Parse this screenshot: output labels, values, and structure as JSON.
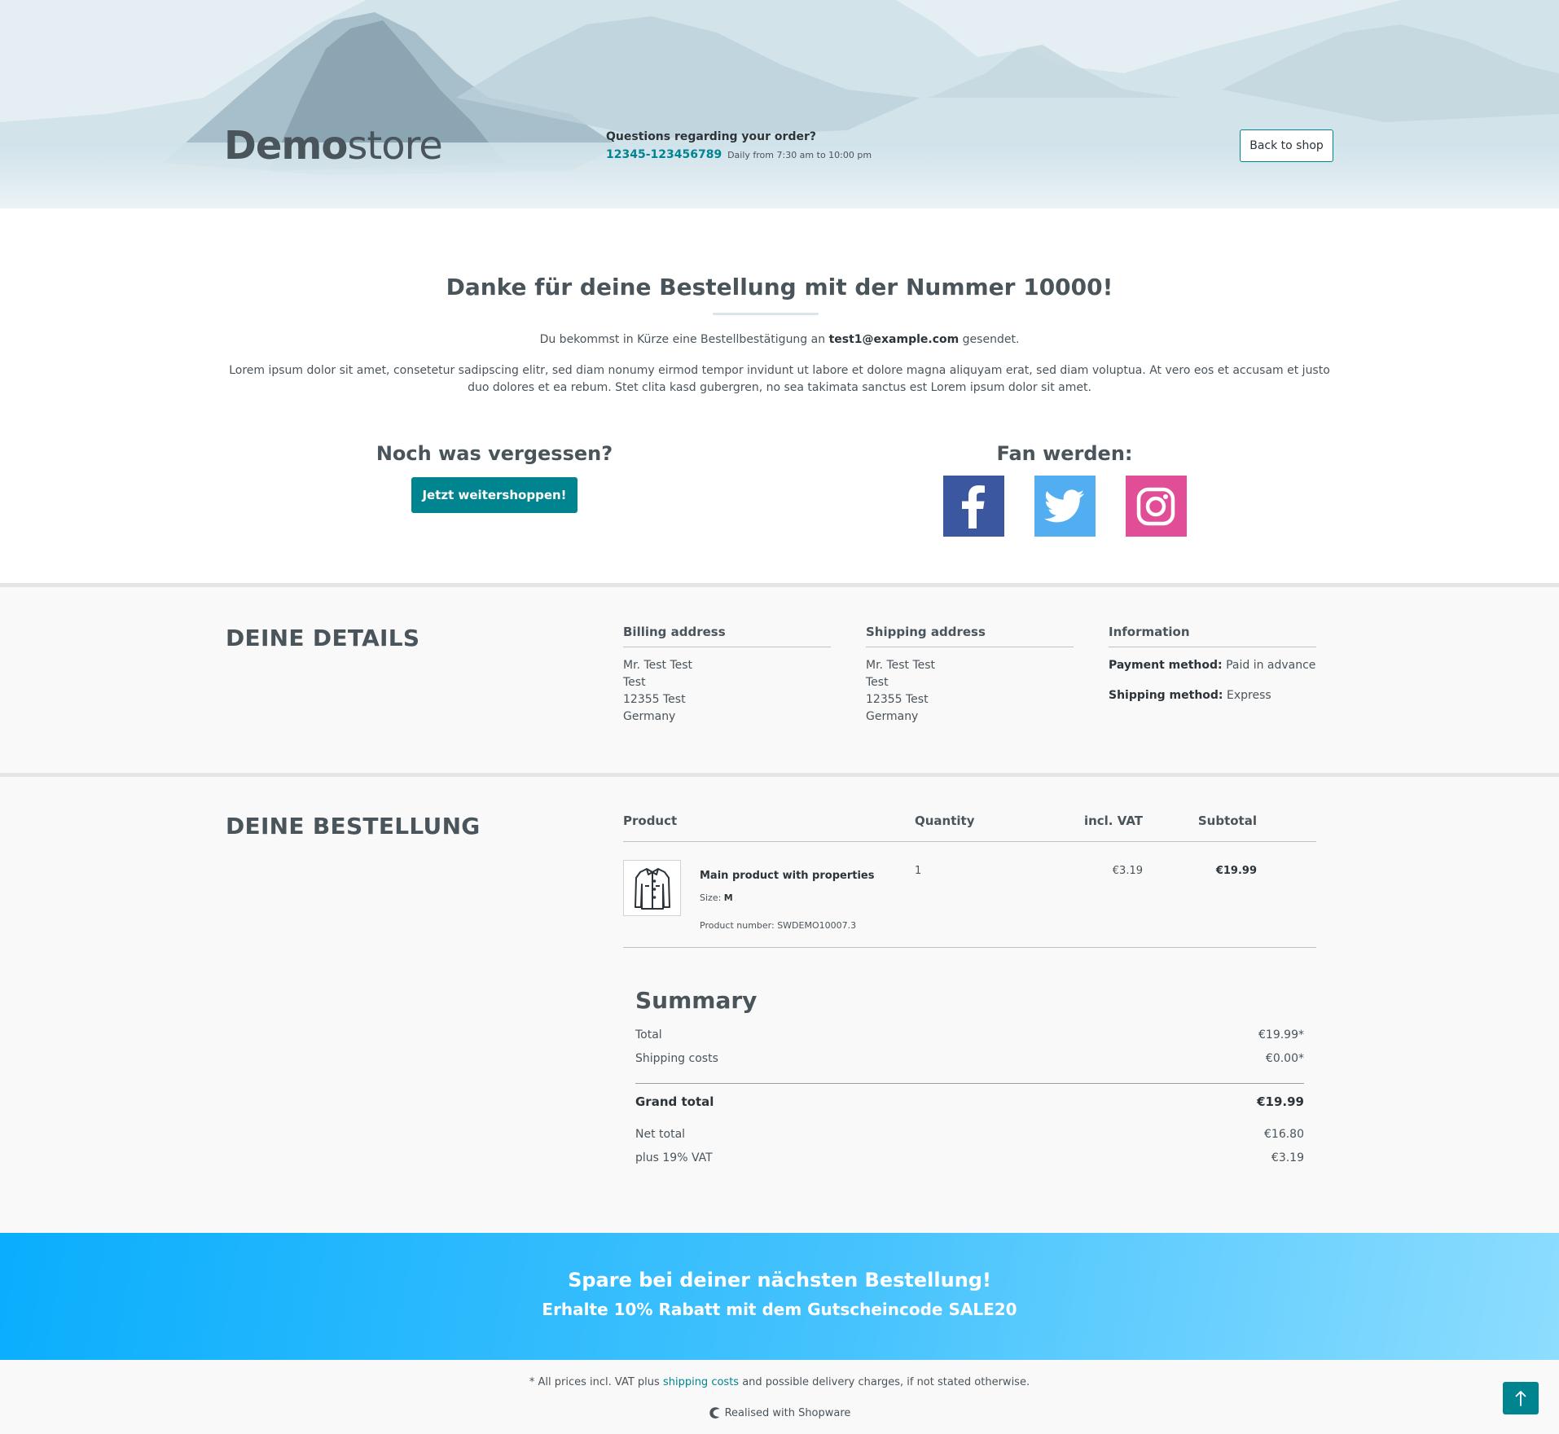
{
  "header": {
    "logo_bold": "Demo",
    "logo_light": "store",
    "hotline_question": "Questions regarding your order?",
    "hotline_number": "12345-123456789",
    "hotline_hours": "Daily from 7:30 am to 10:00 pm",
    "back_label": "Back to shop"
  },
  "thanks": {
    "title": "Danke für deine Bestellung mit der Nummer 10000!",
    "mail_prefix": "Du bekommst in Kürze eine Bestellbestätigung an",
    "mail_address": "test1@example.com",
    "mail_suffix": "gesendet.",
    "lorem": "Lorem ipsum dolor sit amet, consetetur sadipscing elitr, sed diam nonumy eirmod tempor invidunt ut labore et dolore magna aliquyam erat, sed diam voluptua. At vero eos et accusam et justo duo dolores et ea rebum. Stet clita kasd gubergren, no sea takimata sanctus est Lorem ipsum dolor sit amet.",
    "forgot_title": "Noch was vergessen?",
    "shop_button": "Jetzt weitershoppen!",
    "fan_title": "Fan werden:",
    "socials": [
      "facebook-icon",
      "twitter-icon",
      "instagram-icon"
    ]
  },
  "details": {
    "title": "DEINE DETAILS",
    "billing": {
      "heading": "Billing address",
      "lines": [
        "Mr. Test Test",
        "Test",
        "12355 Test",
        "Germany"
      ]
    },
    "shipping": {
      "heading": "Shipping address",
      "lines": [
        "Mr. Test Test",
        "Test",
        "12355 Test",
        "Germany"
      ]
    },
    "information": {
      "heading": "Information",
      "payment_label": "Payment method:",
      "payment_value": "Paid in advance",
      "shipping_label": "Shipping method:",
      "shipping_value": "Express"
    }
  },
  "order": {
    "title": "DEINE BESTELLUNG",
    "columns": [
      "Product",
      "Quantity",
      "incl. VAT",
      "Subtotal"
    ],
    "items": [
      {
        "name": "Main product with properties",
        "size_label": "Size:",
        "size_value": "M",
        "number": "Product number: SWDEMO10007.3",
        "quantity": "1",
        "vat": "€3.19",
        "subtotal": "€19.99",
        "thumbnail": "jacket-icon"
      }
    ]
  },
  "summary": {
    "title": "Summary",
    "total_label": "Total",
    "total_value": "€19.99*",
    "shipping_label": "Shipping costs",
    "shipping_value": "€0.00*",
    "grand_label": "Grand total",
    "grand_value": "€19.99",
    "net_label": "Net total",
    "net_value": "€16.80",
    "vat_label": "plus 19% VAT",
    "vat_value": "€3.19"
  },
  "promo": {
    "line1": "Spare bei deiner nächsten Bestellung!",
    "line2": "Erhalte 10% Rabatt mit dem Gutscheincode SALE20"
  },
  "footer": {
    "vat_prefix": "* All prices incl. VAT plus",
    "vat_link": "shipping costs",
    "vat_suffix": "and possible delivery charges, if not stated otherwise.",
    "realised": "Realised with Shopware"
  },
  "colors": {
    "primary": "#008490",
    "text": "#4a545b",
    "facebook": "#3b57a0",
    "twitter": "#52aef0",
    "instagram": "#e14d97",
    "promo_start": "#0aaefd",
    "promo_end": "#8dddfe"
  }
}
